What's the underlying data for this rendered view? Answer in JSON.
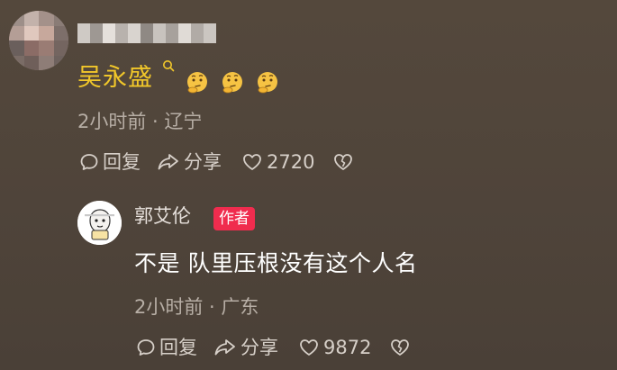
{
  "top_comment": {
    "username": "吴永盛",
    "meta": "2小时前 · 辽宁",
    "actions": {
      "reply_label": "回复",
      "share_label": "分享",
      "like_count": "2720"
    },
    "emoji": [
      "thinking-face-emoji",
      "thinking-face-emoji",
      "thinking-face-emoji"
    ]
  },
  "reply": {
    "username": "郭艾伦",
    "badge": "作者",
    "content": "不是 队里压根没有这个人名",
    "meta": "2小时前 · 广东",
    "actions": {
      "reply_label": "回复",
      "share_label": "分享",
      "like_count": "9872"
    }
  },
  "colors": {
    "background": "#50453b",
    "username_gold": "#f1c72a",
    "meta_gray": "#b7aea5",
    "author_badge": "#f02c4e"
  },
  "icons": {
    "reply": "comment-bubble-icon",
    "share": "share-arrow-icon",
    "like": "heart-outline-icon",
    "dislike": "broken-heart-icon",
    "search": "search-icon"
  }
}
